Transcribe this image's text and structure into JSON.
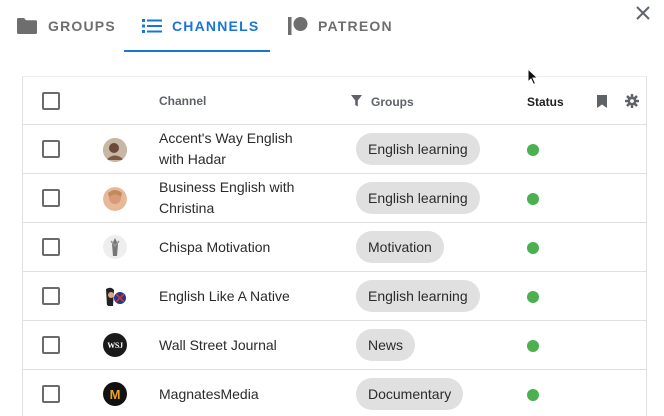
{
  "tabs": [
    {
      "label": "GROUPS",
      "icon": "folder-icon"
    },
    {
      "label": "CHANNELS",
      "icon": "list-icon",
      "active": true
    },
    {
      "label": "PATREON",
      "icon": "patreon-icon"
    }
  ],
  "table": {
    "headers": {
      "channel": "Channel",
      "groups": "Groups",
      "status": "Status"
    },
    "rows": [
      {
        "name": "Accent's Way English with Hadar",
        "group": "English learning",
        "status": "online"
      },
      {
        "name": "Business English with Christina",
        "group": "English learning",
        "status": "online"
      },
      {
        "name": "Chispa Motivation",
        "group": "Motivation",
        "status": "online"
      },
      {
        "name": "English Like A Native",
        "group": "English learning",
        "status": "online"
      },
      {
        "name": "Wall Street Journal",
        "group": "News",
        "status": "online"
      },
      {
        "name": "MagnatesMedia",
        "group": "Documentary",
        "status": "online"
      }
    ]
  },
  "avatar_badges": {
    "wsj": "WSJ",
    "magnates": "M"
  },
  "colors": {
    "accent": "#1976d2",
    "status_online": "#4caf50",
    "chip_bg": "#e0e0e0"
  }
}
